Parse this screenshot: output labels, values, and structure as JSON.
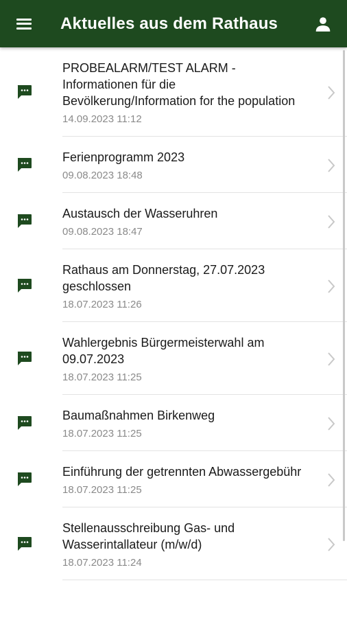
{
  "header": {
    "title": "Aktuelles aus dem Rathaus",
    "menu_icon": "hamburger-menu-icon",
    "user_icon": "person-icon",
    "background": "#1e4a1f"
  },
  "colors": {
    "icon_green": "#1e4a1f",
    "date_gray": "#8a8a8a",
    "chevron_gray": "#c8c8c8"
  },
  "news": [
    {
      "title": "PROBEALARM/TEST ALARM - Informationen für die Bevölkerung/Information for the population",
      "date": "14.09.2023 11:12"
    },
    {
      "title": "Ferienprogramm 2023",
      "date": "09.08.2023 18:48"
    },
    {
      "title": "Austausch der Wasseruhren",
      "date": "09.08.2023 18:47"
    },
    {
      "title": "Rathaus am Donnerstag, 27.07.2023 geschlossen",
      "date": "18.07.2023 11:26"
    },
    {
      "title": "Wahlergebnis Bürgermeisterwahl am 09.07.2023",
      "date": "18.07.2023 11:25"
    },
    {
      "title": "Baumaßnahmen Birkenweg",
      "date": "18.07.2023 11:25"
    },
    {
      "title": "Einführung der getrennten Abwassergebühr",
      "date": "18.07.2023 11:25"
    },
    {
      "title": "Stellenausschreibung Gas- und Wasserintallateur (m/w/d)",
      "date": "18.07.2023 11:24"
    }
  ]
}
